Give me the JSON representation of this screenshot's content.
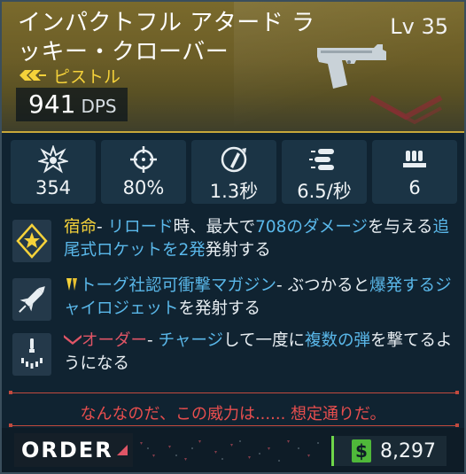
{
  "weapon": {
    "name": "インパクトフル アタード ラッキー・クローバー",
    "level": "Lv 35",
    "type": "ピストル",
    "dps_value": "941",
    "dps_unit": "DPS",
    "rarity_color": "#f5d23a"
  },
  "stats": [
    {
      "icon": "damage-burst-icon",
      "value": "354"
    },
    {
      "icon": "crosshair-icon",
      "value": "80%"
    },
    {
      "icon": "reload-icon",
      "value": "1.3秒"
    },
    {
      "icon": "bullets-icon",
      "value": "6.5/秒"
    },
    {
      "icon": "magazine-icon",
      "value": "6"
    }
  ],
  "talents": [
    {
      "icon": "star-badge-icon",
      "parts": [
        {
          "t": "宿命",
          "c": "y"
        },
        {
          "t": "- ",
          "c": "g"
        },
        {
          "t": "リロード",
          "c": "b"
        },
        {
          "t": "時、最大で",
          "c": "g"
        },
        {
          "t": "708のダメージ",
          "c": "b"
        },
        {
          "t": "を与える",
          "c": "g"
        },
        {
          "t": "追尾式ロケットを2発",
          "c": "b"
        },
        {
          "t": "発射する",
          "c": "g"
        }
      ]
    },
    {
      "icon": "rocket-icon",
      "parts": [
        {
          "t": "トーグ社認可衝撃マガジン",
          "c": "b"
        },
        {
          "t": "- ぶつかると",
          "c": "g"
        },
        {
          "t": "爆発",
          "c": "b"
        },
        {
          "t": "するジャイロジェット",
          "c": "b"
        },
        {
          "t": "を発射する",
          "c": "g"
        }
      ]
    },
    {
      "icon": "burst-shot-icon",
      "parts": [
        {
          "t": "オーダー",
          "c": "r"
        },
        {
          "t": "- ",
          "c": "g"
        },
        {
          "t": "チャージ",
          "c": "b"
        },
        {
          "t": "して一度に",
          "c": "g"
        },
        {
          "t": "複数の弾",
          "c": "b"
        },
        {
          "t": "を撃てるようになる",
          "c": "g"
        }
      ]
    }
  ],
  "flavor_text": "なんなのだ、この威力は...... 想定通りだ。",
  "footer": {
    "brand": "ORDER",
    "currency_symbol": "$",
    "price": "8,297"
  }
}
